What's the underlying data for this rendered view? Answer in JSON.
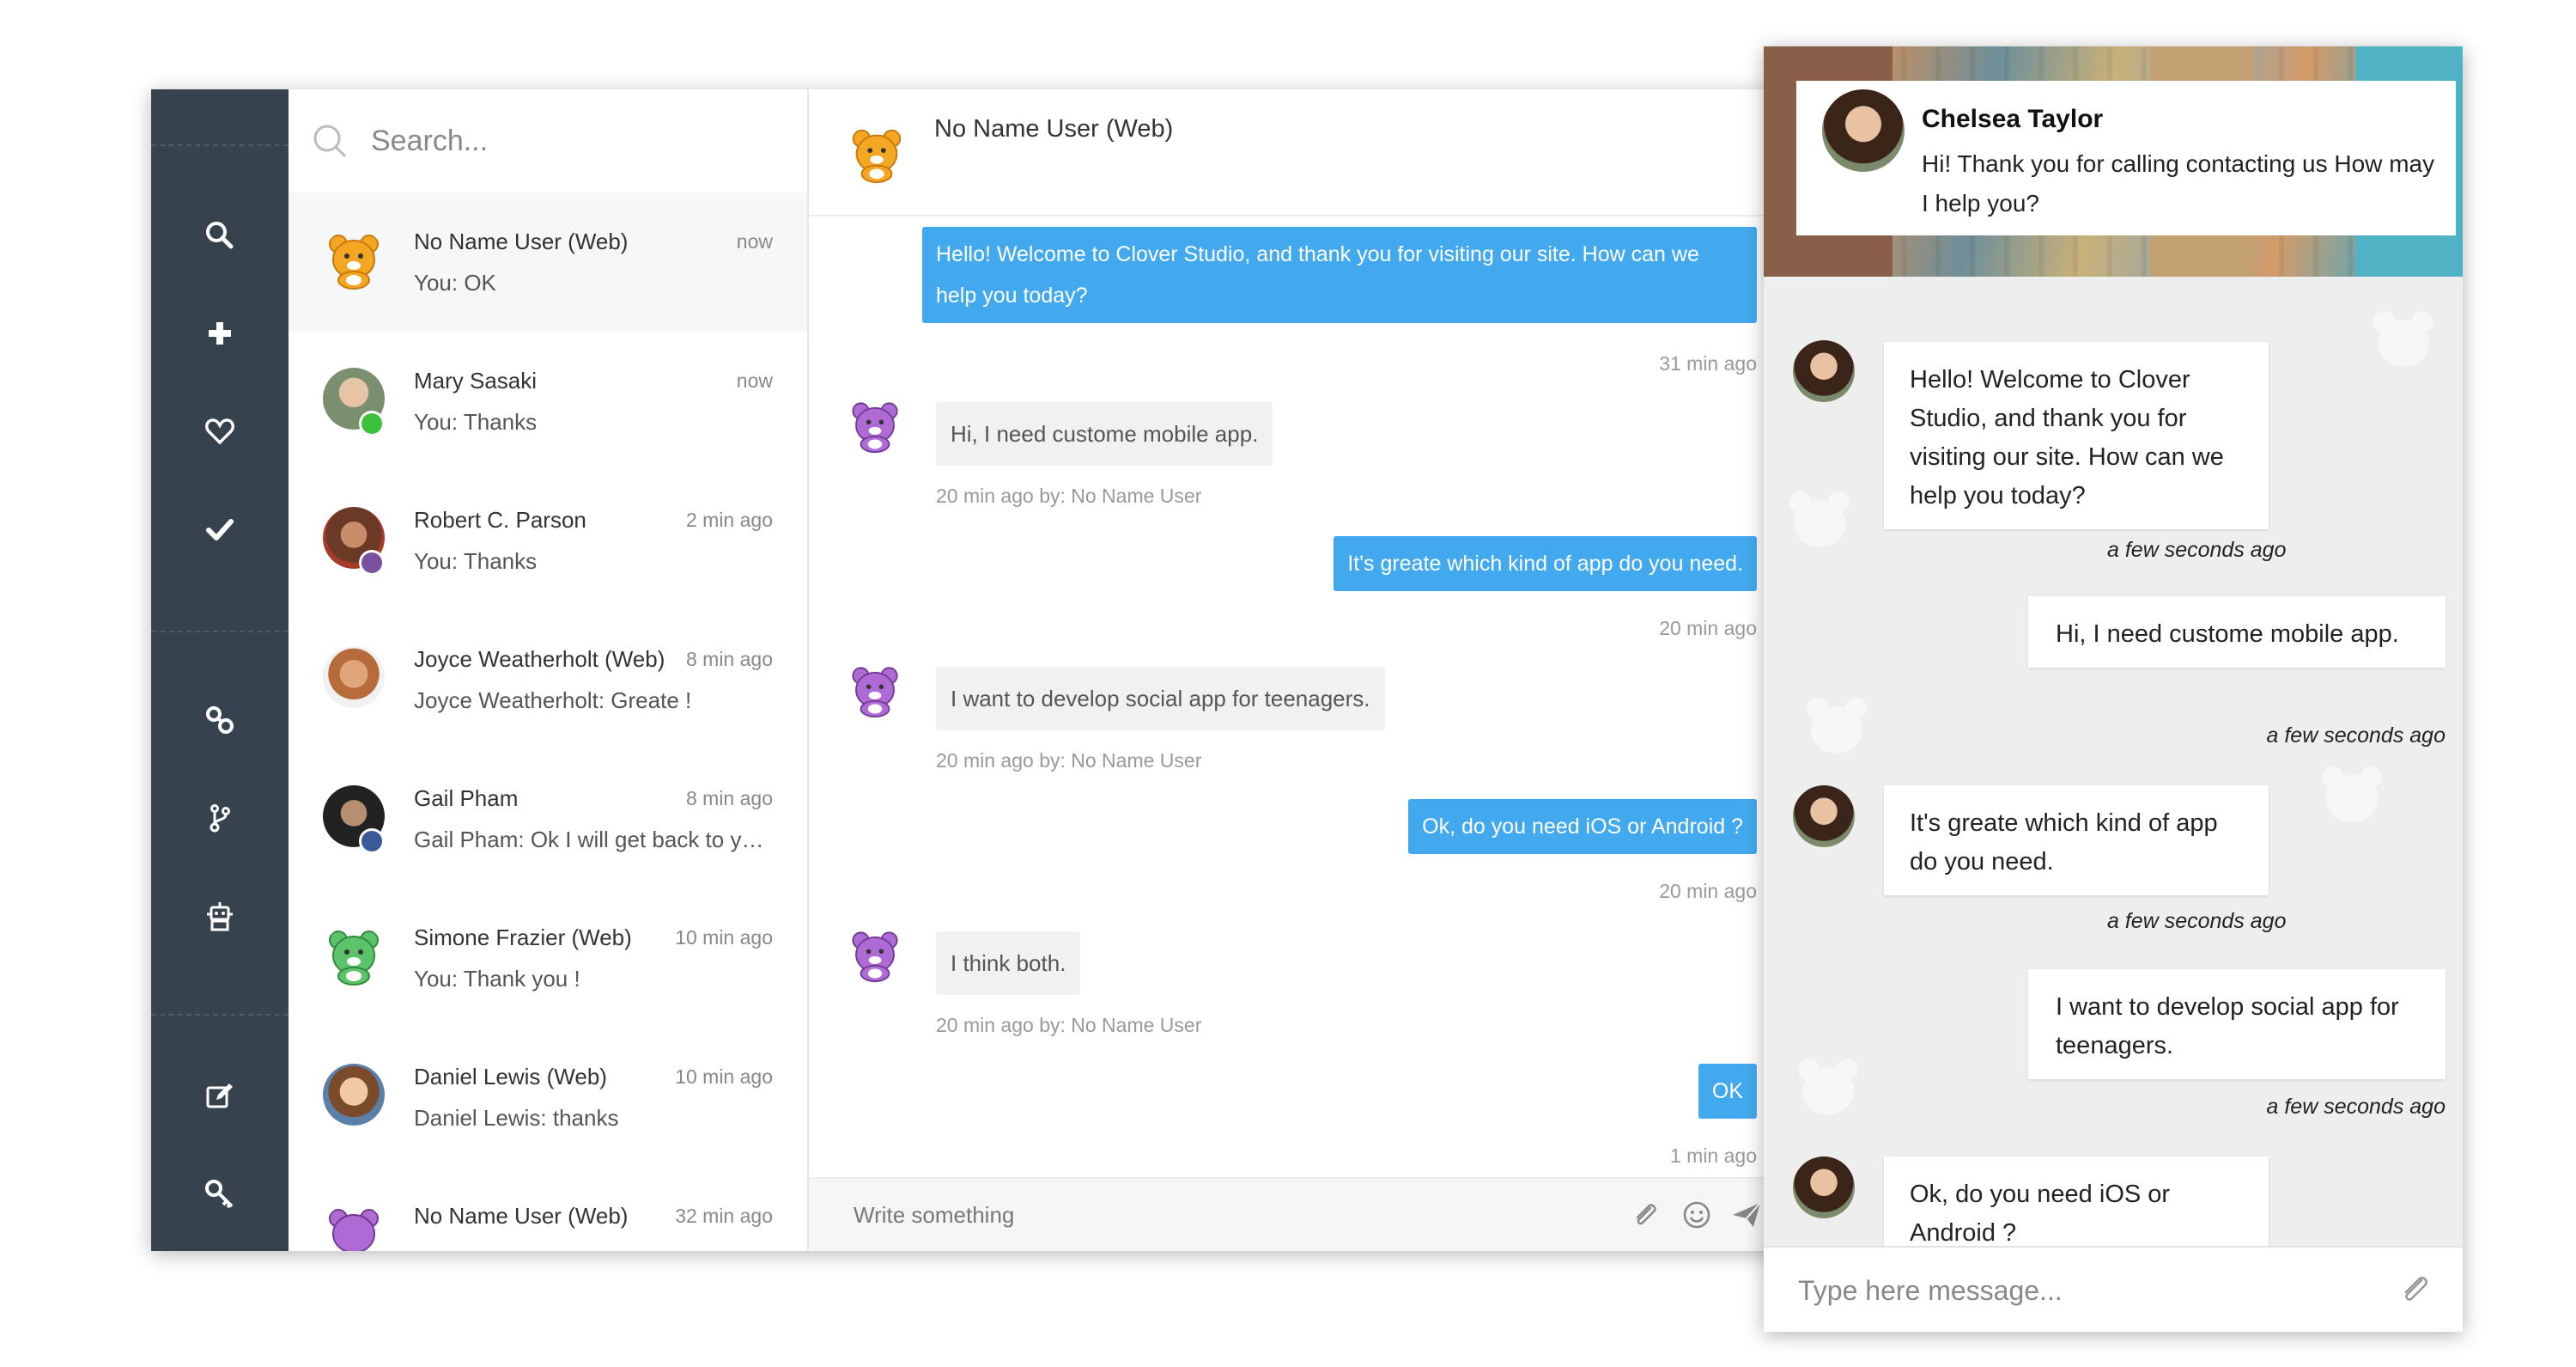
{
  "colors": {
    "rail_bg": "#37424f",
    "accent_blue": "#43a9ef",
    "widget_bg": "#eeeeee"
  },
  "sidebar": {
    "icons": [
      "search-icon",
      "plus-icon",
      "heart-icon",
      "check-icon",
      "link-icon",
      "branch-icon",
      "robot-icon",
      "edit-icon",
      "key-icon"
    ]
  },
  "search": {
    "placeholder": "Search..."
  },
  "conversations": [
    {
      "name": "No Name User (Web)",
      "time": "now",
      "preview": "You: OK",
      "avatar": "bear-orange-avatar"
    },
    {
      "name": "Mary Sasaki",
      "time": "now",
      "preview": "You: Thanks",
      "avatar": "photo-avatar",
      "badge": "line-badge"
    },
    {
      "name": "Robert C. Parson",
      "time": "2 min ago",
      "preview": "You: Thanks",
      "avatar": "photo-avatar",
      "badge": "viber-badge"
    },
    {
      "name": "Joyce Weatherholt (Web)",
      "time": "8 min ago",
      "preview": "Joyce Weatherholt: Greate !",
      "avatar": "photo-avatar"
    },
    {
      "name": "Gail Pham",
      "time": "8 min ago",
      "preview": "Gail Pham: Ok I will get back to you soon",
      "avatar": "photo-avatar",
      "badge": "facebook-badge"
    },
    {
      "name": "Simone Frazier (Web)",
      "time": "10 min ago",
      "preview": "You: Thank you !",
      "avatar": "bear-green-avatar"
    },
    {
      "name": "Daniel Lewis (Web)",
      "time": "10 min ago",
      "preview": "Daniel Lewis: thanks",
      "avatar": "photo-avatar"
    },
    {
      "name": "No Name User (Web)",
      "time": "32 min ago",
      "preview": "",
      "avatar": "bear-purple-avatar"
    }
  ],
  "chat": {
    "title": "No Name User (Web)",
    "messages": [
      {
        "dir": "out",
        "text": "Hello! Welcome to Clover Studio, and thank you for visiting our site. How can we help you today?",
        "meta": "31 min ago"
      },
      {
        "dir": "in",
        "text": "Hi, I need custome mobile app.",
        "meta": "20 min ago by: No Name User"
      },
      {
        "dir": "out",
        "text": "It's greate which kind of app do you need.",
        "meta": "20 min ago"
      },
      {
        "dir": "in",
        "text": "I want to develop social app for teenagers.",
        "meta": "20 min ago by: No Name User"
      },
      {
        "dir": "out",
        "text": "Ok, do you need iOS or Android ?",
        "meta": "20 min ago"
      },
      {
        "dir": "in",
        "text": "I think both.",
        "meta": "20 min ago by: No Name User"
      },
      {
        "dir": "out",
        "text": "OK",
        "meta": "1 min ago"
      }
    ],
    "composer_placeholder": "Write something"
  },
  "widget": {
    "agent_name": "Chelsea Taylor",
    "agent_greeting": "Hi! Thank you for calling contacting us How may I help you?",
    "messages": [
      {
        "dir": "in",
        "text": "Hello! Welcome to Clover Studio, and thank you for visiting our site. How can we help you today?",
        "time": "a few seconds ago"
      },
      {
        "dir": "out",
        "text": "Hi, I need custome mobile app.",
        "time": "a few seconds ago"
      },
      {
        "dir": "in",
        "text": "It's greate which kind of app do you need.",
        "time": "a few seconds ago"
      },
      {
        "dir": "out",
        "text": "I want to develop social app for teenagers.",
        "time": "a few seconds ago"
      },
      {
        "dir": "in",
        "text": "Ok, do you need iOS or Android ?",
        "time": ""
      }
    ],
    "input_placeholder": "Type here message..."
  }
}
